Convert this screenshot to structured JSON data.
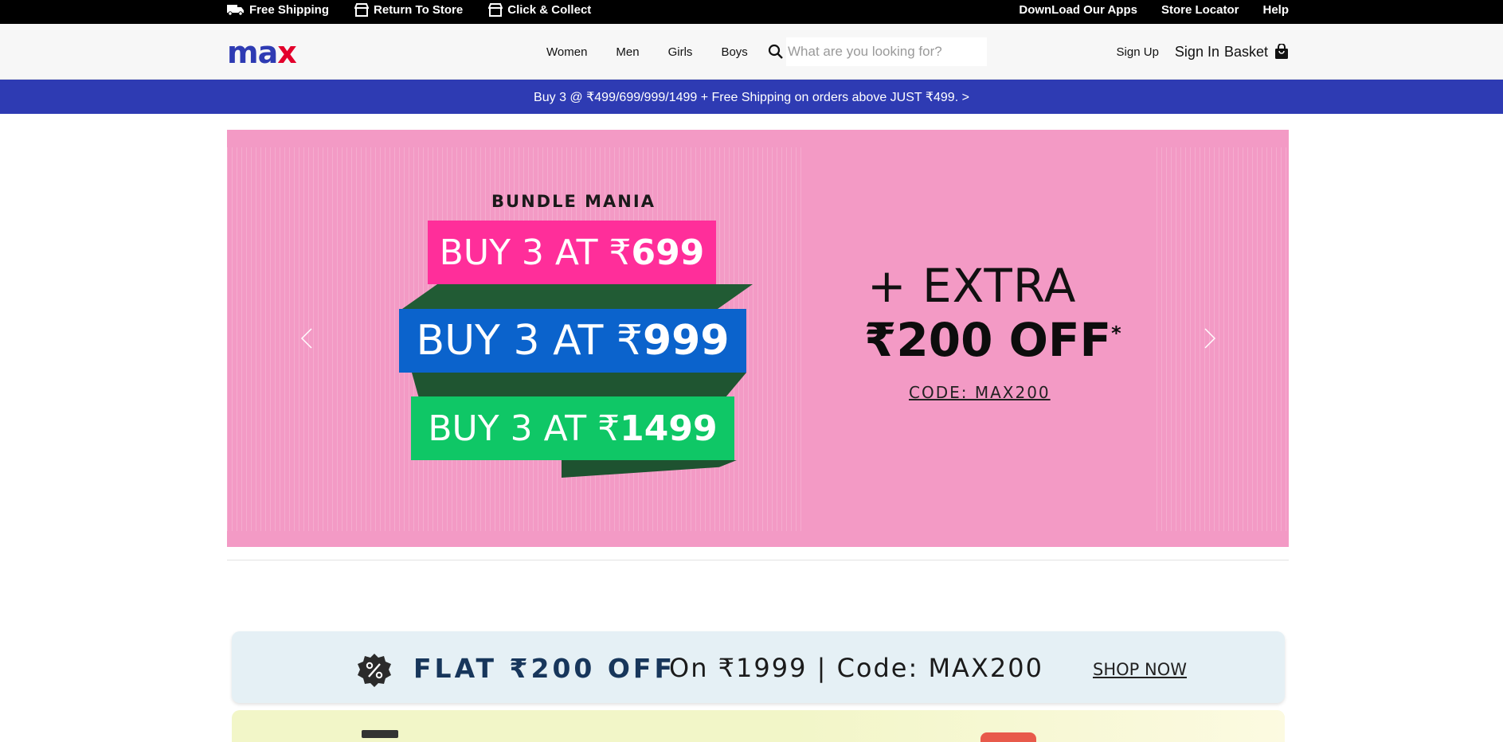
{
  "topbar": {
    "left": [
      "Free Shipping",
      "Return To Store",
      "Click & Collect"
    ],
    "right": [
      "DownLoad Our Apps",
      "Store Locator",
      "Help"
    ]
  },
  "header": {
    "logo": {
      "m": "m",
      "a": "a",
      "x": "x"
    },
    "nav": [
      "Women",
      "Men",
      "Girls",
      "Boys"
    ],
    "search_placeholder": "What are you looking for?",
    "signup": "Sign Up",
    "signin": "Sign In",
    "basket": "Basket"
  },
  "promo": "Buy 3 @ ₹499/699/999/1499 + Free Shipping on orders above JUST ₹499. >",
  "hero": {
    "title": "BUNDLE MANIA",
    "offers": [
      {
        "pre": "BUY 3 AT ₹",
        "amt": "699",
        "color": "#ff2e9a"
      },
      {
        "pre": "BUY 3 AT ₹",
        "amt": "999",
        "color": "#0b63cc"
      },
      {
        "pre": "BUY 3 AT ₹",
        "amt": "1499",
        "color": "#0fc766"
      }
    ],
    "extra": "+ EXTRA",
    "off": "₹200 OFF",
    "off_mark": "*",
    "code": "CODE: MAX200"
  },
  "flat_strip": {
    "flat": "FLAT ₹200 OFF",
    "on": "On ₹1999 | Code: MAX200",
    "cta": "SHOP NOW"
  },
  "colors": {
    "brand_blue": "#2e3bb3",
    "brand_red": "#e3002b",
    "hero_bg": "#f39ac5"
  }
}
